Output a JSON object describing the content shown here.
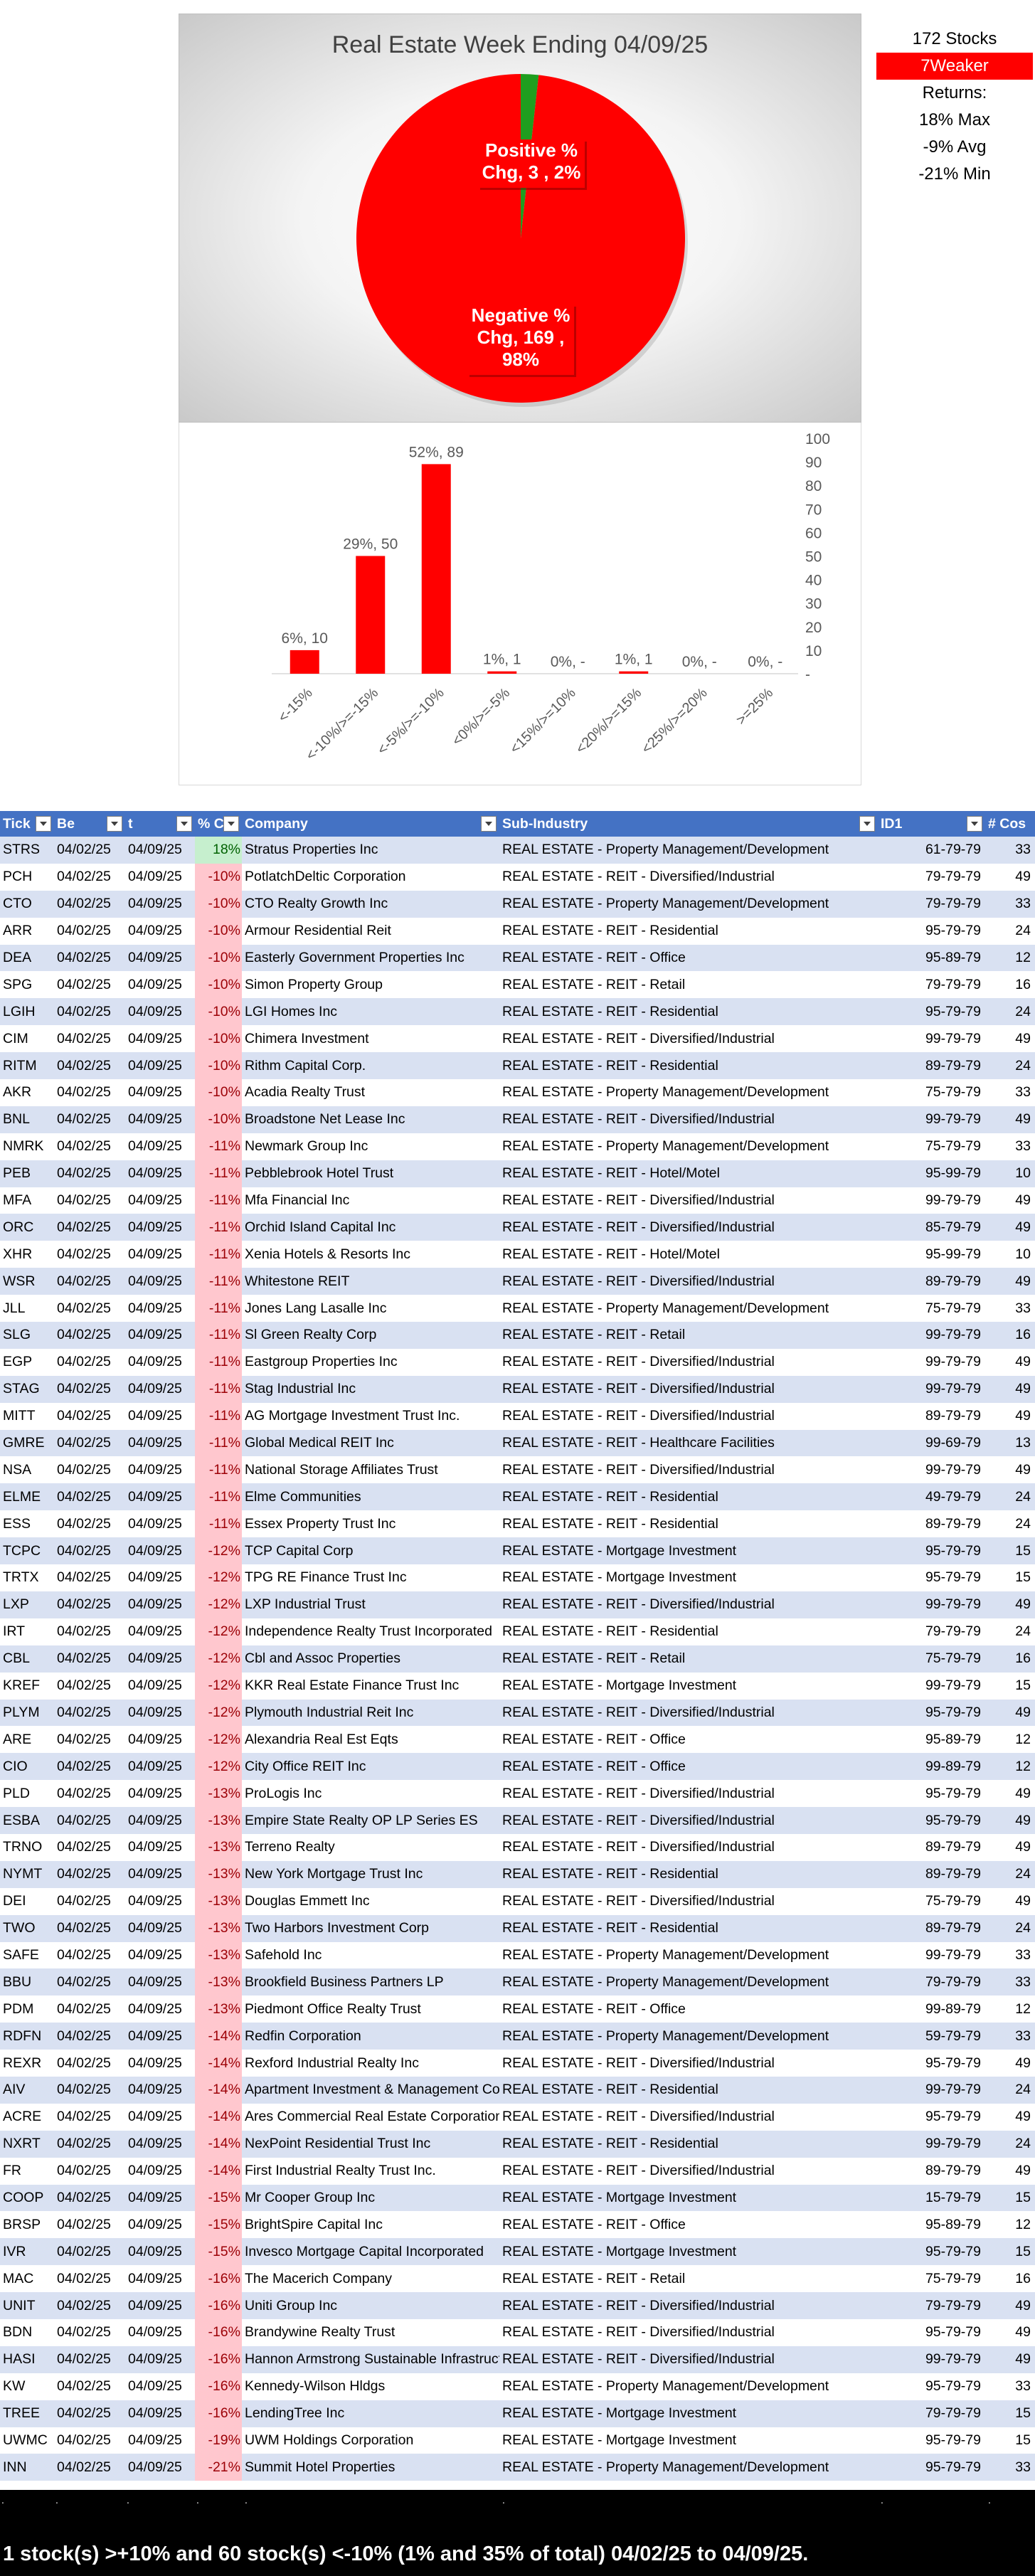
{
  "pie": {
    "title": "Real Estate Week Ending 04/09/25",
    "chart_data": {
      "type": "pie",
      "title": "Real Estate Week Ending 04/09/25",
      "slices": [
        {
          "name": "Positive % Chg",
          "value": 3,
          "percent": "2%",
          "color": "#1f9e1f",
          "label_lines": [
            "Positive %",
            "Chg,  3 , 2%"
          ]
        },
        {
          "name": "Negative % Chg",
          "value": 169,
          "percent": "98%",
          "color": "#ff0000",
          "label_lines": [
            "Negative %",
            "Chg,  169 ,",
            "98%"
          ]
        }
      ]
    }
  },
  "stats": {
    "stocks": "172 Stocks",
    "weaker": "7Weaker",
    "returns": "Returns:",
    "max": "18% Max",
    "avg": "-9% Avg",
    "min": "-21% Min"
  },
  "bars": {
    "chart_data": {
      "type": "bar",
      "categories": [
        "<-15%",
        "<-10%/>=-15%",
        "<-5%/>=-10%",
        "<0%/>=-5%",
        "<15%/>=10%",
        "<20%/>=15%",
        "<25%/>=20%",
        ">=25%"
      ],
      "values": [
        10,
        50,
        89,
        1,
        0,
        1,
        0,
        0
      ],
      "data_labels": [
        "6%, 10",
        "29%, 50",
        "52%, 89",
        "1%, 1",
        "0%, -",
        "1%, 1",
        "0%, -",
        "0%, -"
      ],
      "ylim": [
        0,
        100
      ],
      "yticks": [
        "-",
        "10",
        "20",
        "30",
        "40",
        "50",
        "60",
        "70",
        "80",
        "90",
        "100"
      ],
      "color": "#ff0000",
      "grid": false
    }
  },
  "table": {
    "headers": [
      "Tick",
      "Be",
      "t",
      "% C",
      "Company",
      "Sub-Industry",
      "ID1",
      "# Cos"
    ],
    "rows": [
      [
        "STRS",
        "04/02/25",
        "04/09/25",
        "18%",
        "Stratus Properties Inc",
        "REAL ESTATE - Property Management/Development",
        "61-79-79",
        "33"
      ],
      [
        "PCH",
        "04/02/25",
        "04/09/25",
        "-10%",
        "PotlatchDeltic Corporation",
        "REAL ESTATE - REIT - Diversified/Industrial",
        "79-79-79",
        "49"
      ],
      [
        "CTO",
        "04/02/25",
        "04/09/25",
        "-10%",
        "CTO Realty Growth Inc",
        "REAL ESTATE - Property Management/Development",
        "79-79-79",
        "33"
      ],
      [
        "ARR",
        "04/02/25",
        "04/09/25",
        "-10%",
        "Armour Residential Reit",
        "REAL ESTATE - REIT - Residential",
        "95-79-79",
        "24"
      ],
      [
        "DEA",
        "04/02/25",
        "04/09/25",
        "-10%",
        "Easterly Government Properties Inc",
        "REAL ESTATE - REIT - Office",
        "95-89-79",
        "12"
      ],
      [
        "SPG",
        "04/02/25",
        "04/09/25",
        "-10%",
        "Simon Property Group",
        "REAL ESTATE - REIT - Retail",
        "79-79-79",
        "16"
      ],
      [
        "LGIH",
        "04/02/25",
        "04/09/25",
        "-10%",
        "LGI Homes Inc",
        "REAL ESTATE - REIT - Residential",
        "95-79-79",
        "24"
      ],
      [
        "CIM",
        "04/02/25",
        "04/09/25",
        "-10%",
        "Chimera Investment",
        "REAL ESTATE - REIT - Diversified/Industrial",
        "99-79-79",
        "49"
      ],
      [
        "RITM",
        "04/02/25",
        "04/09/25",
        "-10%",
        "Rithm Capital Corp.",
        "REAL ESTATE - REIT - Residential",
        "89-79-79",
        "24"
      ],
      [
        "AKR",
        "04/02/25",
        "04/09/25",
        "-10%",
        "Acadia Realty Trust",
        "REAL ESTATE - Property Management/Development",
        "75-79-79",
        "33"
      ],
      [
        "BNL",
        "04/02/25",
        "04/09/25",
        "-10%",
        "Broadstone Net Lease Inc",
        "REAL ESTATE - REIT - Diversified/Industrial",
        "99-79-79",
        "49"
      ],
      [
        "NMRK",
        "04/02/25",
        "04/09/25",
        "-11%",
        "Newmark Group Inc",
        "REAL ESTATE - Property Management/Development",
        "75-79-79",
        "33"
      ],
      [
        "PEB",
        "04/02/25",
        "04/09/25",
        "-11%",
        "Pebblebrook Hotel Trust",
        "REAL ESTATE - REIT - Hotel/Motel",
        "95-99-79",
        "10"
      ],
      [
        "MFA",
        "04/02/25",
        "04/09/25",
        "-11%",
        "Mfa Financial Inc",
        "REAL ESTATE - REIT - Diversified/Industrial",
        "99-79-79",
        "49"
      ],
      [
        "ORC",
        "04/02/25",
        "04/09/25",
        "-11%",
        "Orchid Island Capital Inc",
        "REAL ESTATE - REIT - Diversified/Industrial",
        "85-79-79",
        "49"
      ],
      [
        "XHR",
        "04/02/25",
        "04/09/25",
        "-11%",
        "Xenia Hotels & Resorts Inc",
        "REAL ESTATE - REIT - Hotel/Motel",
        "95-99-79",
        "10"
      ],
      [
        "WSR",
        "04/02/25",
        "04/09/25",
        "-11%",
        "Whitestone REIT",
        "REAL ESTATE - REIT - Diversified/Industrial",
        "89-79-79",
        "49"
      ],
      [
        "JLL",
        "04/02/25",
        "04/09/25",
        "-11%",
        "Jones Lang Lasalle Inc",
        "REAL ESTATE - Property Management/Development",
        "75-79-79",
        "33"
      ],
      [
        "SLG",
        "04/02/25",
        "04/09/25",
        "-11%",
        "Sl Green Realty Corp",
        "REAL ESTATE - REIT - Retail",
        "99-79-79",
        "16"
      ],
      [
        "EGP",
        "04/02/25",
        "04/09/25",
        "-11%",
        "Eastgroup Properties Inc",
        "REAL ESTATE - REIT - Diversified/Industrial",
        "99-79-79",
        "49"
      ],
      [
        "STAG",
        "04/02/25",
        "04/09/25",
        "-11%",
        "Stag Industrial Inc",
        "REAL ESTATE - REIT - Diversified/Industrial",
        "99-79-79",
        "49"
      ],
      [
        "MITT",
        "04/02/25",
        "04/09/25",
        "-11%",
        "AG Mortgage Investment Trust Inc.",
        "REAL ESTATE - REIT - Diversified/Industrial",
        "89-79-79",
        "49"
      ],
      [
        "GMRE",
        "04/02/25",
        "04/09/25",
        "-11%",
        "Global Medical REIT Inc",
        "REAL ESTATE - REIT - Healthcare Facilities",
        "99-69-79",
        "13"
      ],
      [
        "NSA",
        "04/02/25",
        "04/09/25",
        "-11%",
        "National Storage Affiliates Trust",
        "REAL ESTATE - REIT - Diversified/Industrial",
        "99-79-79",
        "49"
      ],
      [
        "ELME",
        "04/02/25",
        "04/09/25",
        "-11%",
        "Elme Communities",
        "REAL ESTATE - REIT - Residential",
        "49-79-79",
        "24"
      ],
      [
        "ESS",
        "04/02/25",
        "04/09/25",
        "-11%",
        "Essex Property Trust Inc",
        "REAL ESTATE - REIT - Residential",
        "89-79-79",
        "24"
      ],
      [
        "TCPC",
        "04/02/25",
        "04/09/25",
        "-12%",
        "TCP Capital Corp",
        "REAL ESTATE - Mortgage Investment",
        "95-79-79",
        "15"
      ],
      [
        "TRTX",
        "04/02/25",
        "04/09/25",
        "-12%",
        "TPG RE Finance Trust Inc",
        "REAL ESTATE - Mortgage Investment",
        "95-79-79",
        "15"
      ],
      [
        "LXP",
        "04/02/25",
        "04/09/25",
        "-12%",
        "LXP Industrial Trust",
        "REAL ESTATE - REIT - Diversified/Industrial",
        "99-79-79",
        "49"
      ],
      [
        "IRT",
        "04/02/25",
        "04/09/25",
        "-12%",
        "Independence Realty Trust Incorporated",
        "REAL ESTATE - REIT - Residential",
        "79-79-79",
        "24"
      ],
      [
        "CBL",
        "04/02/25",
        "04/09/25",
        "-12%",
        "Cbl and Assoc Properties",
        "REAL ESTATE - REIT - Retail",
        "75-79-79",
        "16"
      ],
      [
        "KREF",
        "04/02/25",
        "04/09/25",
        "-12%",
        "KKR Real Estate Finance Trust Inc",
        "REAL ESTATE - Mortgage Investment",
        "99-79-79",
        "15"
      ],
      [
        "PLYM",
        "04/02/25",
        "04/09/25",
        "-12%",
        "Plymouth Industrial Reit Inc",
        "REAL ESTATE - REIT - Diversified/Industrial",
        "95-79-79",
        "49"
      ],
      [
        "ARE",
        "04/02/25",
        "04/09/25",
        "-12%",
        "Alexandria Real Est Eqts",
        "REAL ESTATE - REIT - Office",
        "95-89-79",
        "12"
      ],
      [
        "CIO",
        "04/02/25",
        "04/09/25",
        "-12%",
        "City Office REIT Inc",
        "REAL ESTATE - REIT - Office",
        "99-89-79",
        "12"
      ],
      [
        "PLD",
        "04/02/25",
        "04/09/25",
        "-13%",
        "ProLogis Inc",
        "REAL ESTATE - REIT - Diversified/Industrial",
        "95-79-79",
        "49"
      ],
      [
        "ESBA",
        "04/02/25",
        "04/09/25",
        "-13%",
        "Empire State Realty OP LP Series ES",
        "REAL ESTATE - REIT - Diversified/Industrial",
        "95-79-79",
        "49"
      ],
      [
        "TRNO",
        "04/02/25",
        "04/09/25",
        "-13%",
        "Terreno Realty",
        "REAL ESTATE - REIT - Diversified/Industrial",
        "89-79-79",
        "49"
      ],
      [
        "NYMT",
        "04/02/25",
        "04/09/25",
        "-13%",
        "New York Mortgage Trust Inc",
        "REAL ESTATE - REIT - Residential",
        "89-79-79",
        "24"
      ],
      [
        "DEI",
        "04/02/25",
        "04/09/25",
        "-13%",
        "Douglas Emmett Inc",
        "REAL ESTATE - REIT - Diversified/Industrial",
        "75-79-79",
        "49"
      ],
      [
        "TWO",
        "04/02/25",
        "04/09/25",
        "-13%",
        "Two Harbors Investment Corp",
        "REAL ESTATE - REIT - Residential",
        "89-79-79",
        "24"
      ],
      [
        "SAFE",
        "04/02/25",
        "04/09/25",
        "-13%",
        "Safehold Inc",
        "REAL ESTATE - Property Management/Development",
        "99-79-79",
        "33"
      ],
      [
        "BBU",
        "04/02/25",
        "04/09/25",
        "-13%",
        "Brookfield Business Partners LP",
        "REAL ESTATE - Property Management/Development",
        "79-79-79",
        "33"
      ],
      [
        "PDM",
        "04/02/25",
        "04/09/25",
        "-13%",
        "Piedmont Office Realty Trust",
        "REAL ESTATE - REIT - Office",
        "99-89-79",
        "12"
      ],
      [
        "RDFN",
        "04/02/25",
        "04/09/25",
        "-14%",
        "Redfin Corporation",
        "REAL ESTATE - Property Management/Development",
        "59-79-79",
        "33"
      ],
      [
        "REXR",
        "04/02/25",
        "04/09/25",
        "-14%",
        "Rexford Industrial Realty Inc",
        "REAL ESTATE - REIT - Diversified/Industrial",
        "95-79-79",
        "49"
      ],
      [
        "AIV",
        "04/02/25",
        "04/09/25",
        "-14%",
        "Apartment Investment & Management Co",
        "REAL ESTATE - REIT - Residential",
        "99-79-79",
        "24"
      ],
      [
        "ACRE",
        "04/02/25",
        "04/09/25",
        "-14%",
        "Ares Commercial Real Estate Corporation",
        "REAL ESTATE - REIT - Diversified/Industrial",
        "95-79-79",
        "49"
      ],
      [
        "NXRT",
        "04/02/25",
        "04/09/25",
        "-14%",
        "NexPoint Residential Trust Inc",
        "REAL ESTATE - REIT - Residential",
        "99-79-79",
        "24"
      ],
      [
        "FR",
        "04/02/25",
        "04/09/25",
        "-14%",
        "First Industrial Realty Trust Inc.",
        "REAL ESTATE - REIT - Diversified/Industrial",
        "89-79-79",
        "49"
      ],
      [
        "COOP",
        "04/02/25",
        "04/09/25",
        "-15%",
        "Mr Cooper Group Inc",
        "REAL ESTATE - Mortgage Investment",
        "15-79-79",
        "15"
      ],
      [
        "BRSP",
        "04/02/25",
        "04/09/25",
        "-15%",
        "BrightSpire Capital Inc",
        "REAL ESTATE - REIT - Office",
        "95-89-79",
        "12"
      ],
      [
        "IVR",
        "04/02/25",
        "04/09/25",
        "-15%",
        "Invesco Mortgage Capital Incorporated",
        "REAL ESTATE - Mortgage Investment",
        "95-79-79",
        "15"
      ],
      [
        "MAC",
        "04/02/25",
        "04/09/25",
        "-16%",
        "The Macerich Company",
        "REAL ESTATE - REIT - Retail",
        "75-79-79",
        "16"
      ],
      [
        "UNIT",
        "04/02/25",
        "04/09/25",
        "-16%",
        "Uniti Group Inc",
        "REAL ESTATE - REIT - Diversified/Industrial",
        "79-79-79",
        "49"
      ],
      [
        "BDN",
        "04/02/25",
        "04/09/25",
        "-16%",
        "Brandywine Realty Trust",
        "REAL ESTATE - REIT - Diversified/Industrial",
        "95-79-79",
        "49"
      ],
      [
        "HASI",
        "04/02/25",
        "04/09/25",
        "-16%",
        "Hannon Armstrong Sustainable Infrastructure",
        "REAL ESTATE - REIT - Diversified/Industrial",
        "99-79-79",
        "49"
      ],
      [
        "KW",
        "04/02/25",
        "04/09/25",
        "-16%",
        "Kennedy-Wilson Hldgs",
        "REAL ESTATE - Property Management/Development",
        "95-79-79",
        "33"
      ],
      [
        "TREE",
        "04/02/25",
        "04/09/25",
        "-16%",
        "LendingTree Inc",
        "REAL ESTATE - Mortgage Investment",
        "79-79-79",
        "15"
      ],
      [
        "UWMC",
        "04/02/25",
        "04/09/25",
        "-19%",
        "UWM Holdings Corporation",
        "REAL ESTATE - Mortgage Investment",
        "95-79-79",
        "15"
      ],
      [
        "INN",
        "04/02/25",
        "04/09/25",
        "-21%",
        "Summit Hotel Properties",
        "REAL ESTATE - Property Management/Development",
        "95-79-79",
        "33"
      ]
    ]
  },
  "footer": {
    "summary": "1 stock(s) >+10% and 60 stock(s) <-10% (1% and 35% of total) 04/02/25 to 04/09/25."
  }
}
